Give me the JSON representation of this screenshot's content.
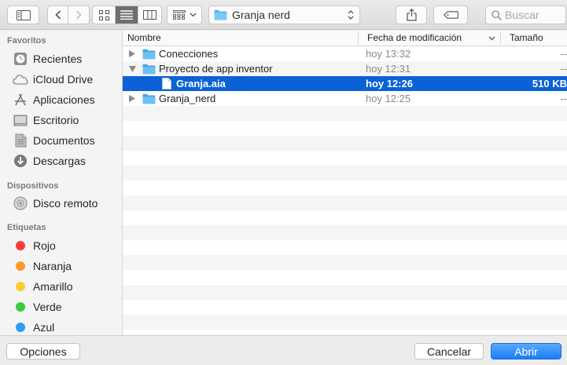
{
  "toolbar": {
    "location": "Granja nerd",
    "search_placeholder": "Buscar"
  },
  "sidebar": {
    "favorites_title": "Favoritos",
    "favorites": [
      {
        "label": "Recientes",
        "icon": "clock-icon"
      },
      {
        "label": "iCloud Drive",
        "icon": "cloud-icon"
      },
      {
        "label": "Aplicaciones",
        "icon": "applications-icon"
      },
      {
        "label": "Escritorio",
        "icon": "desktop-icon"
      },
      {
        "label": "Documentos",
        "icon": "document-icon"
      },
      {
        "label": "Descargas",
        "icon": "download-icon"
      }
    ],
    "devices_title": "Dispositivos",
    "devices": [
      {
        "label": "Disco remoto",
        "icon": "disc-icon"
      }
    ],
    "tags_title": "Etiquetas",
    "tags": [
      {
        "label": "Rojo",
        "color": "#fc3d39"
      },
      {
        "label": "Naranja",
        "color": "#fd9a2a"
      },
      {
        "label": "Amarillo",
        "color": "#fecb2f"
      },
      {
        "label": "Verde",
        "color": "#3dca3b"
      },
      {
        "label": "Azul",
        "color": "#2e9cf6"
      }
    ]
  },
  "list": {
    "columns": {
      "name": "Nombre",
      "date": "Fecha de modificación",
      "size": "Tamaño"
    },
    "rows": [
      {
        "name": "Conecciones",
        "date": "hoy 13:32",
        "size": "--"
      },
      {
        "name": "Proyecto de app inventor",
        "date": "hoy 12:31",
        "size": "--"
      },
      {
        "name": "Granja.aia",
        "date": "hoy 12:26",
        "size": "510 KB"
      },
      {
        "name": "Granja_nerd",
        "date": "hoy 12:25",
        "size": "--"
      }
    ]
  },
  "footer": {
    "options_label": "Opciones",
    "cancel_label": "Cancelar",
    "open_label": "Abrir"
  },
  "colors": {
    "accent": "#0b62d6",
    "folder": "#5ab6ee"
  }
}
